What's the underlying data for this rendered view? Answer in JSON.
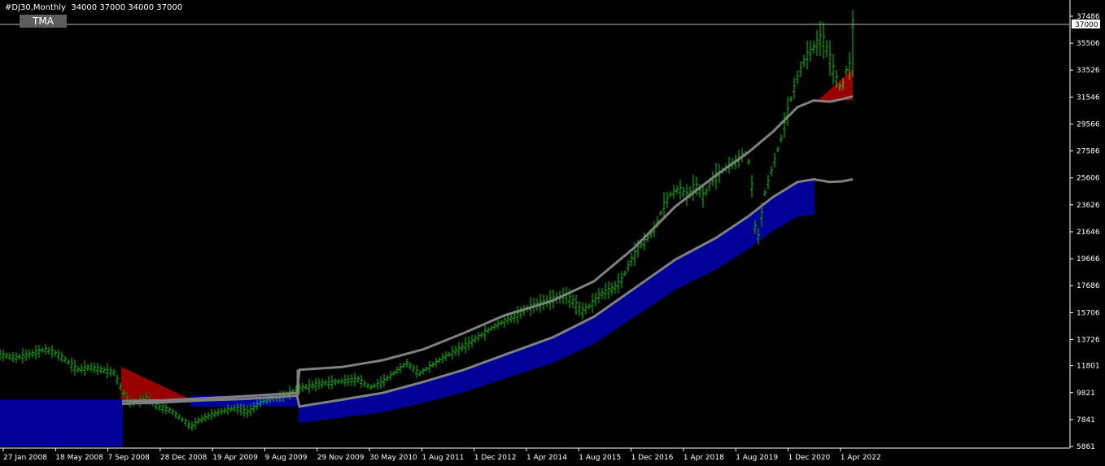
{
  "header": {
    "symbol_label": "#DJ30,Monthly  34000 37000 34000 37000",
    "indicator_label": "TMA"
  },
  "colors": {
    "background": "#000000",
    "candles": "#00c800",
    "band_lines": "#808080",
    "fill_blue": "#0000ff",
    "fill_red": "#ff0000",
    "axis": "#ffffff"
  },
  "price_marker": "37000",
  "chart_data": {
    "type": "line",
    "title": "#DJ30,Monthly",
    "ylim": [
      5861,
      37486
    ],
    "y_ticks": [
      37486,
      35506,
      33526,
      31546,
      29566,
      27586,
      25606,
      23626,
      21646,
      19666,
      17686,
      15706,
      13726,
      11801,
      9821,
      7841,
      5861
    ],
    "x_ticks": [
      "27 Jan 2008",
      "18 May 2008",
      "7 Sep 2008",
      "28 Dec 2008",
      "19 Apr 2009",
      "9 Aug 2009",
      "29 Nov 2009",
      "30 May 2010",
      "1 Aug 2011",
      "1 Dec 2012",
      "1 Apr 2014",
      "1 Aug 2015",
      "1 Dec 2016",
      "1 Apr 2018",
      "1 Aug 2019",
      "1 Dec 2020",
      "1 Apr 2022"
    ],
    "current_price": 37000,
    "series": [
      {
        "name": "#DJ30",
        "points": [
          [
            0,
            12600
          ],
          [
            20,
            12400
          ],
          [
            40,
            12700
          ],
          [
            55,
            13000
          ],
          [
            65,
            12800
          ],
          [
            75,
            12500
          ],
          [
            85,
            12000
          ],
          [
            95,
            11500
          ],
          [
            110,
            11700
          ],
          [
            125,
            11500
          ],
          [
            140,
            11300
          ],
          [
            150,
            10000
          ],
          [
            160,
            9000
          ],
          [
            170,
            9200
          ],
          [
            180,
            9400
          ],
          [
            195,
            8800
          ],
          [
            210,
            8500
          ],
          [
            225,
            7800
          ],
          [
            235,
            7300
          ],
          [
            245,
            7800
          ],
          [
            260,
            8200
          ],
          [
            275,
            8500
          ],
          [
            290,
            8700
          ],
          [
            305,
            8400
          ],
          [
            320,
            9100
          ],
          [
            335,
            9400
          ],
          [
            350,
            9600
          ],
          [
            365,
            10100
          ],
          [
            380,
            10300
          ],
          [
            395,
            10500
          ],
          [
            410,
            10600
          ],
          [
            425,
            10700
          ],
          [
            440,
            10800
          ],
          [
            455,
            10200
          ],
          [
            470,
            10600
          ],
          [
            485,
            11300
          ],
          [
            500,
            12000
          ],
          [
            515,
            11200
          ],
          [
            530,
            11800
          ],
          [
            545,
            12400
          ],
          [
            560,
            12900
          ],
          [
            575,
            13400
          ],
          [
            590,
            14000
          ],
          [
            605,
            14600
          ],
          [
            620,
            15100
          ],
          [
            635,
            15500
          ],
          [
            650,
            16100
          ],
          [
            665,
            16400
          ],
          [
            680,
            16700
          ],
          [
            695,
            17000
          ],
          [
            705,
            16500
          ],
          [
            715,
            15800
          ],
          [
            725,
            16200
          ],
          [
            735,
            16900
          ],
          [
            745,
            17300
          ],
          [
            755,
            17500
          ],
          [
            765,
            18200
          ],
          [
            775,
            19500
          ],
          [
            785,
            20500
          ],
          [
            795,
            21100
          ],
          [
            805,
            21900
          ],
          [
            815,
            23500
          ],
          [
            825,
            24500
          ],
          [
            835,
            24800
          ],
          [
            845,
            24300
          ],
          [
            855,
            25100
          ],
          [
            865,
            24200
          ],
          [
            875,
            25500
          ],
          [
            885,
            26000
          ],
          [
            895,
            26500
          ],
          [
            905,
            26800
          ],
          [
            915,
            27500
          ],
          [
            922,
            26500
          ],
          [
            930,
            20500
          ],
          [
            940,
            24500
          ],
          [
            950,
            26500
          ],
          [
            960,
            28500
          ],
          [
            970,
            31000
          ],
          [
            980,
            33000
          ],
          [
            990,
            34500
          ],
          [
            1000,
            35200
          ],
          [
            1010,
            36000
          ],
          [
            1018,
            34800
          ],
          [
            1026,
            33200
          ],
          [
            1034,
            32000
          ],
          [
            1040,
            33500
          ],
          [
            1046,
            34000
          ],
          [
            1048,
            37000
          ]
        ]
      },
      {
        "name": "TMA upper",
        "points": [
          [
            150,
            9200
          ],
          [
            200,
            9250
          ],
          [
            250,
            9400
          ],
          [
            300,
            9550
          ],
          [
            365,
            9800
          ],
          [
            368,
            11500
          ],
          [
            420,
            11700
          ],
          [
            470,
            12200
          ],
          [
            520,
            13000
          ],
          [
            570,
            14200
          ],
          [
            620,
            15500
          ],
          [
            680,
            16600
          ],
          [
            730,
            18000
          ],
          [
            780,
            20500
          ],
          [
            830,
            23500
          ],
          [
            880,
            25800
          ],
          [
            920,
            27500
          ],
          [
            950,
            29000
          ],
          [
            980,
            30800
          ],
          [
            1000,
            31300
          ],
          [
            1020,
            31200
          ],
          [
            1035,
            31400
          ],
          [
            1048,
            31600
          ]
        ]
      },
      {
        "name": "TMA lower",
        "points": [
          [
            150,
            9000
          ],
          [
            200,
            9100
          ],
          [
            250,
            9250
          ],
          [
            300,
            9350
          ],
          [
            365,
            9600
          ],
          [
            368,
            8800
          ],
          [
            420,
            9300
          ],
          [
            470,
            9800
          ],
          [
            520,
            10600
          ],
          [
            570,
            11500
          ],
          [
            620,
            12600
          ],
          [
            680,
            13900
          ],
          [
            730,
            15400
          ],
          [
            780,
            17500
          ],
          [
            830,
            19600
          ],
          [
            880,
            21200
          ],
          [
            920,
            22800
          ],
          [
            950,
            24200
          ],
          [
            980,
            25300
          ],
          [
            1000,
            25500
          ],
          [
            1020,
            25300
          ],
          [
            1035,
            25350
          ],
          [
            1048,
            25500
          ]
        ]
      }
    ],
    "fills": [
      {
        "color": "blue",
        "from_x": 0,
        "to_x": 150,
        "top": 9300,
        "bottom": 5861
      },
      {
        "color": "red",
        "from_x": 150,
        "to_x": 235,
        "top": 11700,
        "bottom": 9300
      },
      {
        "color": "blue",
        "from_x": 235,
        "to_x": 365,
        "top": 9600,
        "bottom": 8800
      },
      {
        "color": "blue",
        "from_x": 368,
        "to_x": 1000,
        "band": "lower"
      },
      {
        "color": "red",
        "from_x": 1005,
        "to_x": 1048,
        "top": 33600,
        "bottom": 31300
      }
    ]
  }
}
